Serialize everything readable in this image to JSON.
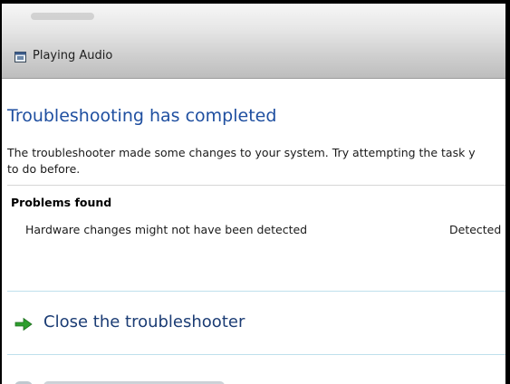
{
  "window": {
    "title": "Playing Audio",
    "icon": "troubleshooter-window-icon"
  },
  "main": {
    "heading": "Troubleshooting has completed",
    "description_lines": [
      "The troubleshooter made some changes to your system. Try attempting the task y",
      "to do before."
    ],
    "problems": {
      "title": "Problems found",
      "rows": [
        {
          "name": "Hardware changes might not have been detected",
          "status": "Detected"
        }
      ]
    },
    "actions": [
      {
        "label": "Close the troubleshooter",
        "icon": "green-arrow-icon"
      }
    ]
  },
  "colors": {
    "heading": "#1f4fa0",
    "action_label": "#1b3c74",
    "arrow": "#2e9e2e",
    "separator": "#bfe0ec"
  }
}
